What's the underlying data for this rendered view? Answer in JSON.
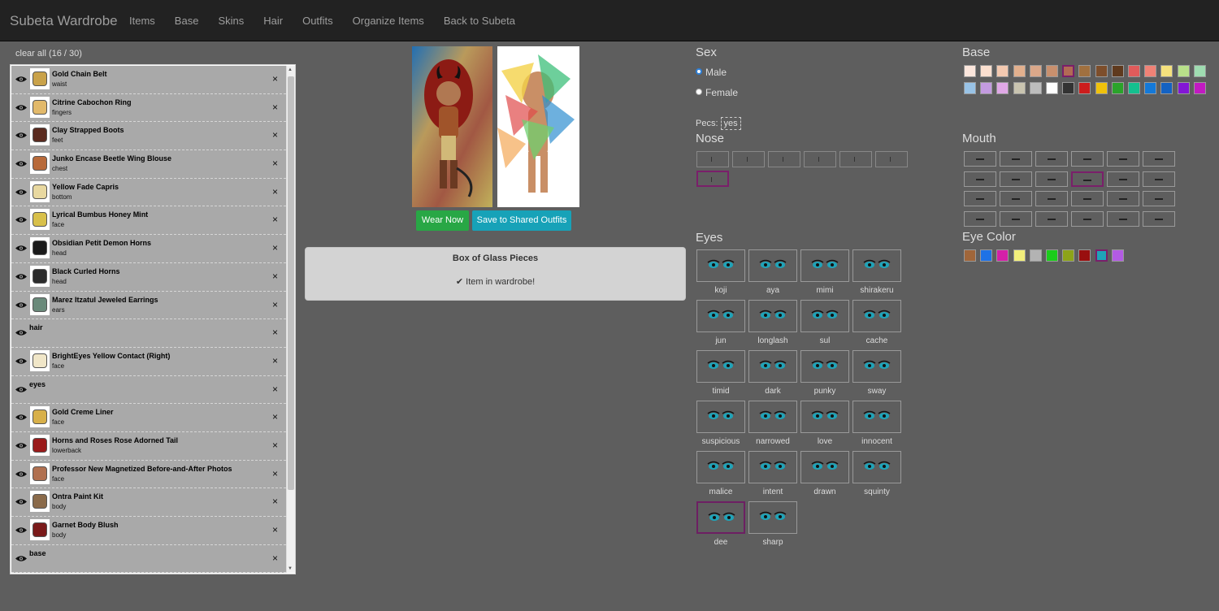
{
  "navbar": {
    "brand": "Subeta Wardrobe",
    "links": [
      "Items",
      "Base",
      "Skins",
      "Hair",
      "Outfits",
      "Organize Items",
      "Back to Subeta"
    ]
  },
  "wardrobe": {
    "clear_all": "clear all (16 / 30)",
    "remove_glyph": "×",
    "items": [
      {
        "name": "Gold Chain Belt",
        "slot": "waist"
      },
      {
        "name": "Citrine Cabochon Ring",
        "slot": "fingers"
      },
      {
        "name": "Clay Strapped Boots",
        "slot": "feet"
      },
      {
        "name": "Junko Encase Beetle Wing Blouse",
        "slot": "chest"
      },
      {
        "name": "Yellow Fade Capris",
        "slot": "bottom"
      },
      {
        "name": "Lyrical Bumbus Honey Mint",
        "slot": "face"
      },
      {
        "name": "Obsidian Petit Demon Horns",
        "slot": "head"
      },
      {
        "name": "Black Curled Horns",
        "slot": "head"
      },
      {
        "name": "Marez Itzatul Jeweled Earrings",
        "slot": "ears"
      },
      {
        "name": "hair",
        "slot": ""
      },
      {
        "name": "BrightEyes Yellow Contact (Right)",
        "slot": "face"
      },
      {
        "name": "eyes",
        "slot": ""
      },
      {
        "name": "Gold Creme Liner",
        "slot": "face"
      },
      {
        "name": "Horns and Roses Rose Adorned Tail",
        "slot": "lowerback"
      },
      {
        "name": "Professor New Magnetized Before-and-After Photos",
        "slot": "face"
      },
      {
        "name": "Ontra Paint Kit",
        "slot": "body"
      },
      {
        "name": "Garnet Body Blush",
        "slot": "body"
      },
      {
        "name": "base",
        "slot": ""
      }
    ]
  },
  "actions": {
    "wear_now": "Wear Now",
    "save_shared": "Save to Shared Outfits"
  },
  "infobox": {
    "title": "Box of Glass Pieces",
    "status": "Item in wardrobe!"
  },
  "sex": {
    "heading": "Sex",
    "options": [
      "Male",
      "Female"
    ],
    "selected": "Male"
  },
  "pecs": {
    "label": "Pecs:",
    "value": "yes"
  },
  "nose": {
    "heading": "Nose",
    "count": 7,
    "selected_index": 6
  },
  "eyes": {
    "heading": "Eyes",
    "styles": [
      "koji",
      "aya",
      "mimi",
      "shirakeru",
      "jun",
      "longlash",
      "sul",
      "cache",
      "timid",
      "dark",
      "punky",
      "sway",
      "suspicious",
      "narrowed",
      "love",
      "innocent",
      "malice",
      "intent",
      "drawn",
      "squinty",
      "dee",
      "sharp"
    ],
    "selected": "dee"
  },
  "base": {
    "heading": "Base",
    "colors": [
      "#fbe6dc",
      "#fbe0d0",
      "#f3c9b0",
      "#e2b08e",
      "#dba88a",
      "#c9906e",
      "#b26a55",
      "#a0703f",
      "#7d4e2b",
      "#5f3a1e",
      "#e05b5b",
      "#f08276",
      "#f5e17d",
      "#b8e08a",
      "#9fdcb1",
      "#99c3e6",
      "#c39be0",
      "#e0a8e6",
      "#c9c4b0",
      "#bdbdbd",
      "#ffffff",
      "#333333",
      "#cc1d1d",
      "#f0c20b",
      "#2ba32b",
      "#14c08f",
      "#1479d8",
      "#1462c2",
      "#8317d6",
      "#c21ac2"
    ],
    "selected_index": 6
  },
  "mouth": {
    "heading": "Mouth",
    "count": 24,
    "selected_index": 9
  },
  "eye_color": {
    "heading": "Eye Color",
    "colors": [
      "#a0663a",
      "#1e72e6",
      "#d41fa8",
      "#f2ef7b",
      "#b3b3b3",
      "#1bcc1b",
      "#8da319",
      "#990f0f",
      "#1fa3b8",
      "#b35be3"
    ],
    "selected_index": 8
  }
}
